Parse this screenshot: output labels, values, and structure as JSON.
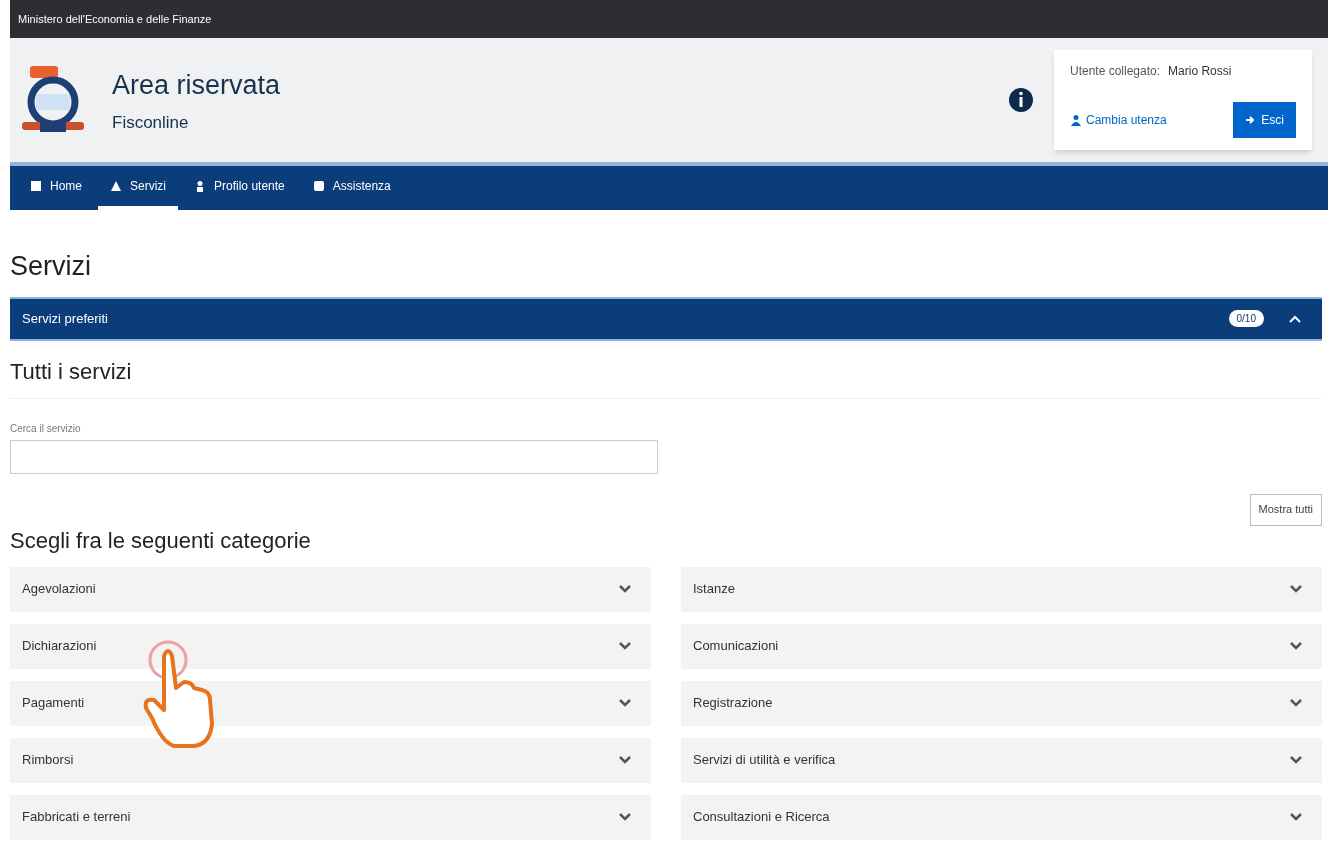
{
  "top_bar": {
    "text": "Ministero dell'Economia e delle Finanze"
  },
  "header": {
    "title": "Area riservata",
    "subtitle": "Fisconline",
    "user_label": "Utente collegato:",
    "user_name": "Mario Rossi",
    "change_link": "Cambia utenza",
    "logout_button": "Esci"
  },
  "nav": [
    {
      "label": "Home",
      "selected": false
    },
    {
      "label": "Servizi",
      "selected": true
    },
    {
      "label": "Profilo utente",
      "selected": false
    },
    {
      "label": "Assistenza",
      "selected": false
    }
  ],
  "page_title": "Servizi",
  "favorites": {
    "title": "Servizi preferiti",
    "badge": "0/10",
    "expanded": true
  },
  "all_services": {
    "title": "Tutti i servizi",
    "search_label": "Cerca il servizio",
    "show_all_button": "Mostra tutti"
  },
  "categories_title": "Scegli fra le seguenti categorie",
  "categories": [
    {
      "label": "Agevolazioni",
      "expanded": false
    },
    {
      "label": "Istanze",
      "expanded": false
    },
    {
      "label": "Dichiarazioni",
      "expanded": false
    },
    {
      "label": "Comunicazioni",
      "expanded": false
    },
    {
      "label": "Pagamenti",
      "expanded": false
    },
    {
      "label": "Registrazione",
      "expanded": false
    },
    {
      "label": "Rimborsi",
      "expanded": false
    },
    {
      "label": "Servizi di utilità e verifica",
      "expanded": false
    },
    {
      "label": "Fabbricati e terreni",
      "expanded": false
    },
    {
      "label": "Consultazioni e Ricerca",
      "expanded": false
    }
  ]
}
